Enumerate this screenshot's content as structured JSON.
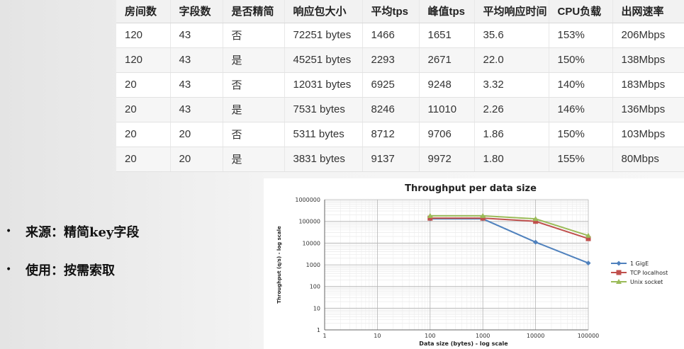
{
  "table": {
    "headers": [
      "房间数",
      "字段数",
      "是否精简",
      "响应包大小",
      "平均tps",
      "峰值tps",
      "平均响应时间",
      "CPU负载",
      "出网速率"
    ],
    "rows": [
      [
        "120",
        "43",
        "否",
        "72251 bytes",
        "1466",
        "1651",
        "35.6",
        "153%",
        "206Mbps"
      ],
      [
        "120",
        "43",
        "是",
        "45251 bytes",
        "2293",
        "2671",
        "22.0",
        "150%",
        "138Mbps"
      ],
      [
        "20",
        "43",
        "否",
        "12031 bytes",
        "6925",
        "9248",
        "3.32",
        "140%",
        "183Mbps"
      ],
      [
        "20",
        "43",
        "是",
        "7531 bytes",
        "8246",
        "11010",
        "2.26",
        "146%",
        "136Mbps"
      ],
      [
        "20",
        "20",
        "否",
        "5311 bytes",
        "8712",
        "9706",
        "1.86",
        "150%",
        "103Mbps"
      ],
      [
        "20",
        "20",
        "是",
        "3831 bytes",
        "9137",
        "9972",
        "1.80",
        "155%",
        "80Mbps"
      ]
    ]
  },
  "bullets": [
    {
      "marker": "•",
      "text": "来源：精简key字段"
    },
    {
      "marker": "•",
      "text": "使用：按需索取"
    }
  ],
  "chart_data": {
    "type": "line",
    "title": "Throughput per data size",
    "xlabel": "Data size (bytes) - log scale",
    "ylabel": "Throughput (q/s) - log scale",
    "xscale": "log",
    "yscale": "log",
    "xlim": [
      1,
      100000
    ],
    "ylim": [
      1,
      1000000
    ],
    "x_ticks": [
      "1",
      "10",
      "100",
      "1000",
      "10000",
      "100000"
    ],
    "y_ticks": [
      "1",
      "10",
      "100",
      "1000",
      "10000",
      "100000",
      "1000000"
    ],
    "grid": true,
    "legend_position": "right",
    "x": [
      100,
      1000,
      10000,
      100000
    ],
    "series": [
      {
        "name": "1 GigE",
        "color": "#4f81bd",
        "marker": "diamond",
        "values": [
          130000,
          130000,
          11000,
          1200
        ]
      },
      {
        "name": "TCP localhost",
        "color": "#c0504d",
        "marker": "square",
        "values": [
          140000,
          140000,
          100000,
          16000
        ]
      },
      {
        "name": "Unix socket",
        "color": "#9bbb59",
        "marker": "triangle",
        "values": [
          180000,
          180000,
          130000,
          22000
        ]
      }
    ]
  }
}
